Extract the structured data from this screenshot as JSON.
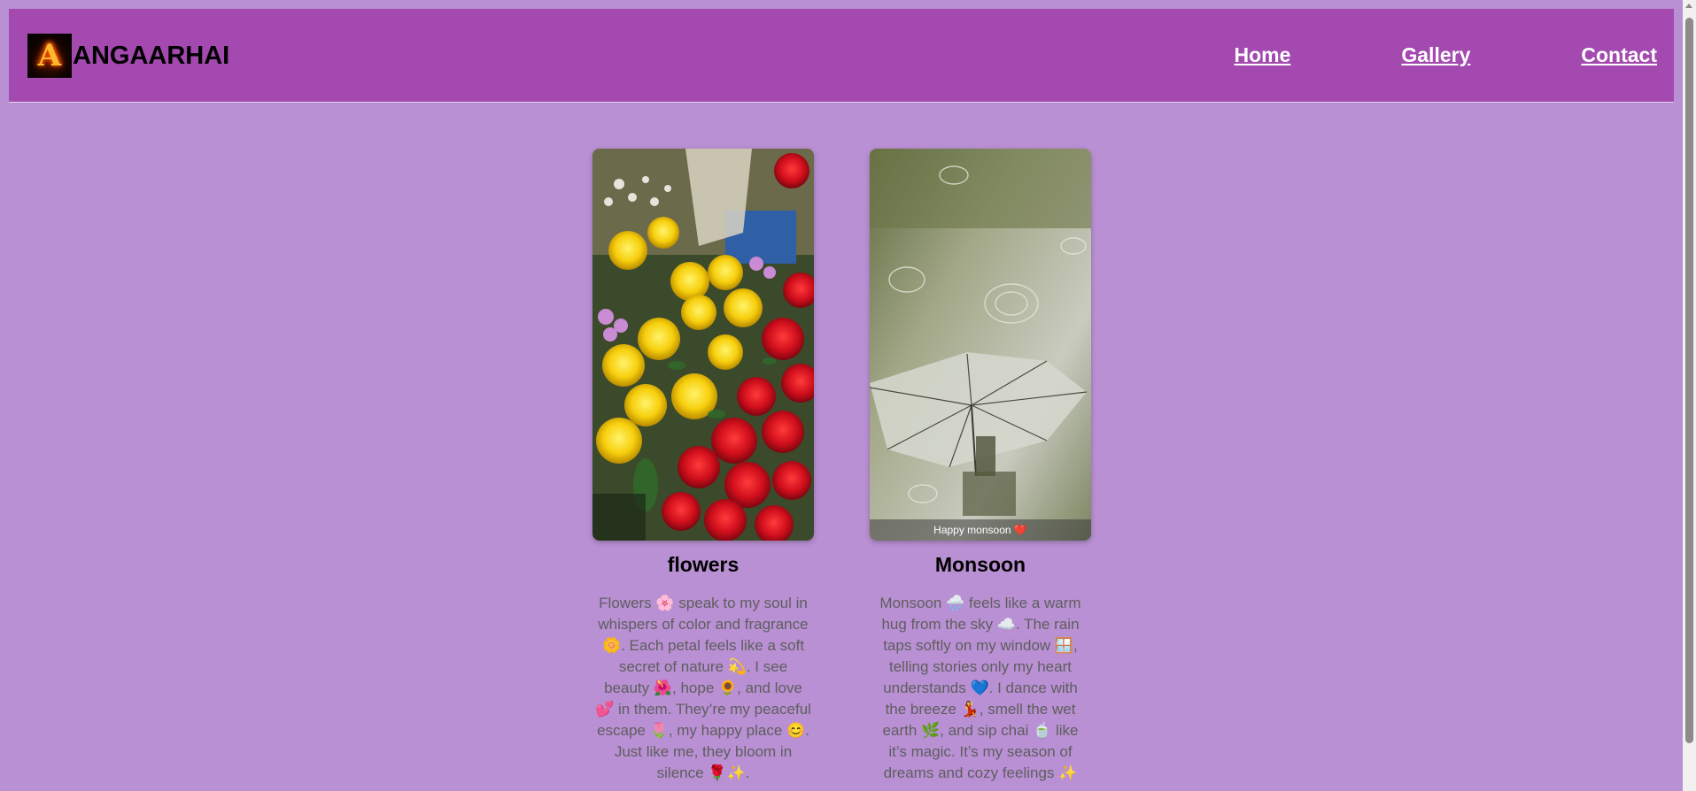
{
  "header": {
    "logo_letter": "A",
    "brand_name": "ANGAARHAI",
    "nav": [
      "Home",
      "Gallery",
      "Contact"
    ]
  },
  "cards": [
    {
      "title": "flowers",
      "image_icon": "flowers-photo",
      "caption": "",
      "text": "Flowers 🌸 speak to my soul in whispers of color and fragrance 🌼. Each petal feels like a soft secret of nature 💫. I see beauty 🌺, hope 🌻, and love 💕 in them. They’re my peaceful escape 🌷, my happy place 😊. Just like me, they bloom in silence 🌹✨."
    },
    {
      "title": "Monsoon",
      "image_icon": "monsoon-umbrella-photo",
      "caption": "Happy monsoon ❤️",
      "text": "Monsoon 🌧️ feels like a warm hug from the sky ☁️. The rain taps softly on my window 🪟, telling stories only my heart understands 💙. I dance with the breeze 💃, smell the wet earth 🌿, and sip chai 🍵 like it’s magic. It’s my season of dreams and cozy feelings ✨"
    }
  ],
  "colors": {
    "background": "#b990d3",
    "navbar": "#a349b0",
    "nav_link": "#ffffff",
    "card_text": "#5e5e5e"
  }
}
